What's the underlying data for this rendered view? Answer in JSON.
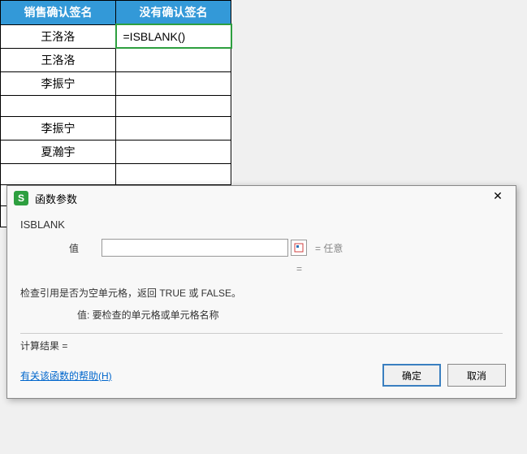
{
  "table": {
    "headers": [
      "销售确认签名",
      "没有确认签名"
    ],
    "rows": [
      [
        "王洛洛",
        "=ISBLANK()"
      ],
      [
        "王洛洛",
        ""
      ],
      [
        "李振宁",
        ""
      ],
      [
        "",
        ""
      ],
      [
        "李振宁",
        ""
      ],
      [
        "夏瀚宇",
        ""
      ],
      [
        "",
        ""
      ],
      [
        "",
        ""
      ],
      [
        "",
        ""
      ]
    ]
  },
  "dialog": {
    "title": "函数参数",
    "icon_letter": "S",
    "function_name": "ISBLANK",
    "param_label": "值",
    "param_value": "",
    "param_result": "= 任意",
    "result_equals": "=",
    "description": "检查引用是否为空单元格，返回 TRUE 或 FALSE。",
    "arg_description": "值: 要检查的单元格或单元格名称",
    "calc_result_label": "计算结果 =",
    "help_link": "有关该函数的帮助(H)",
    "ok_label": "确定",
    "cancel_label": "取消"
  }
}
